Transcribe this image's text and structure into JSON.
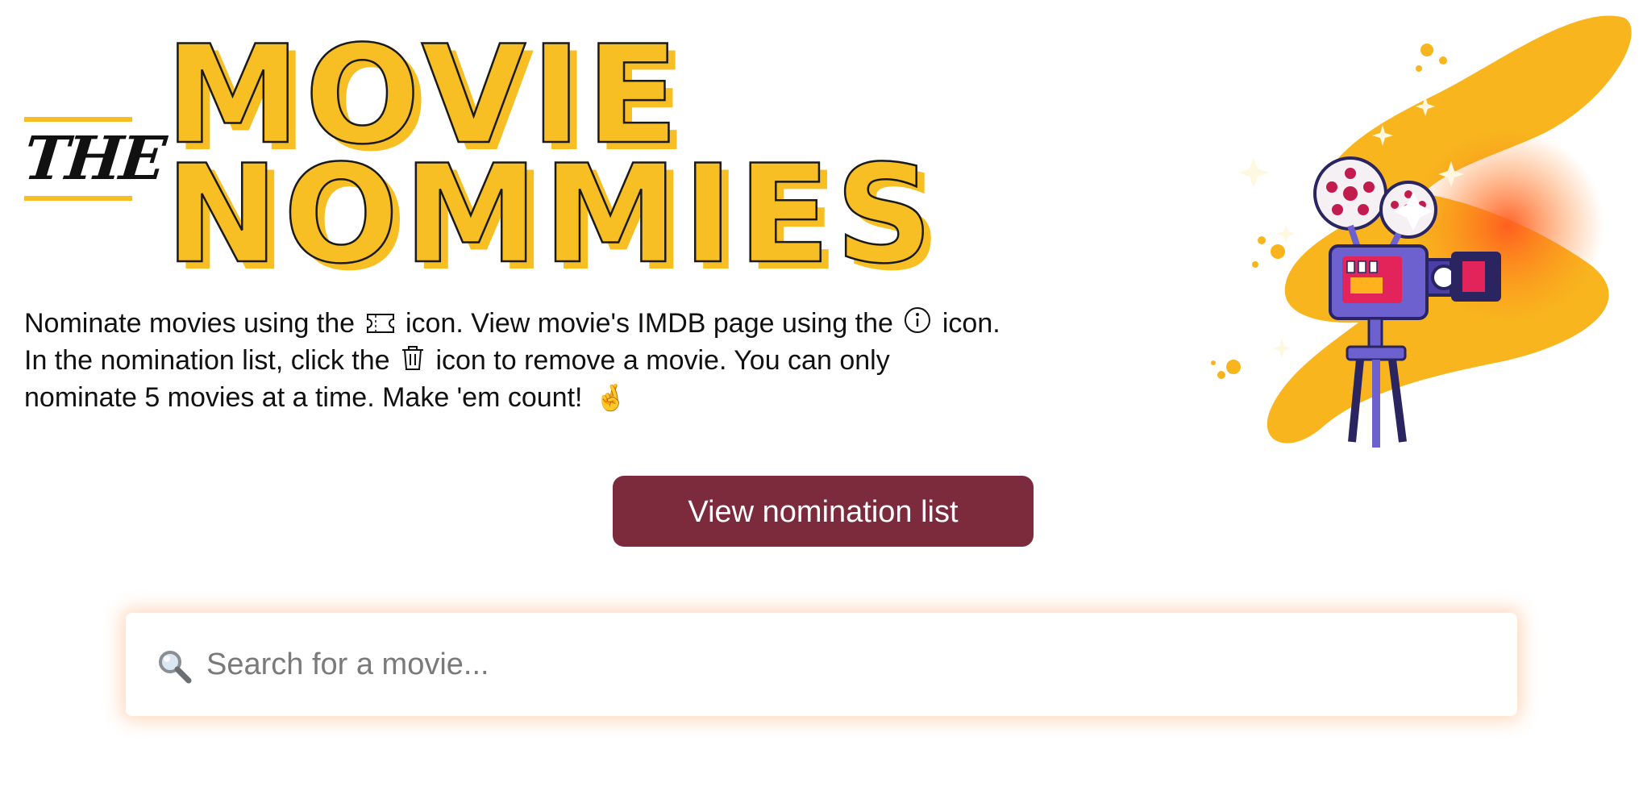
{
  "logo": {
    "prefix": "THE",
    "line1": "MOVIE",
    "line2": "NOMMIES",
    "accent_color": "#f7bf23"
  },
  "instructions": {
    "line1_a": "Nominate movies using the",
    "line1_icon_nominate": "ticket-icon",
    "line1_b": "icon. View movie's IMDB page using the",
    "line1_icon_info": "info-icon",
    "line1_c": "icon.",
    "line2_a": "In the nomination list, click the",
    "line2_icon_remove": "trash-icon",
    "line2_b": "icon to remove a movie. You can only",
    "line3": "nominate 5 movies at a time. Make 'em count!",
    "emoji": "🤞"
  },
  "actions": {
    "view_nominations_label": "View nomination list",
    "button_color": "#7c2b3d"
  },
  "search": {
    "placeholder": "Search for a movie...",
    "value": "",
    "icon": "magnifier-icon"
  },
  "illustration": {
    "icon": "movie-projector-illustration"
  }
}
